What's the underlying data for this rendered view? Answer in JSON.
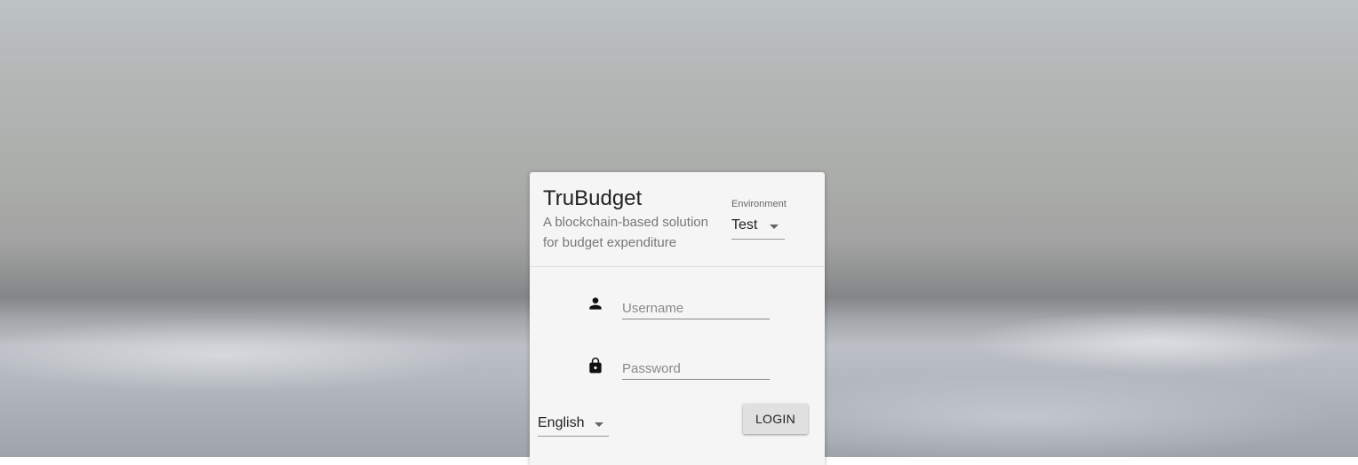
{
  "app": {
    "title": "TruBudget",
    "subtitle": "A blockchain-based solution for budget expenditure"
  },
  "environment": {
    "label": "Environment",
    "selected": "Test"
  },
  "login_form": {
    "username": {
      "icon": "person-icon",
      "placeholder": "Username",
      "value": ""
    },
    "password": {
      "icon": "lock-icon",
      "placeholder": "Password",
      "value": ""
    },
    "language": {
      "selected": "English"
    },
    "login_label": "LOGIN"
  },
  "colors": {
    "card_background": "#f5f5f5",
    "button_background": "#e0e0e0",
    "text_primary": "#222222",
    "text_secondary": "#777777"
  }
}
